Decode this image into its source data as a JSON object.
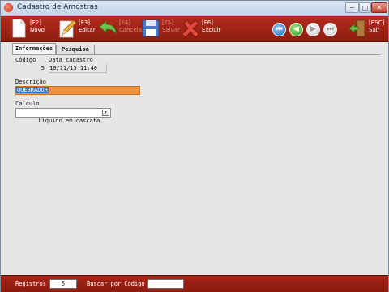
{
  "window": {
    "title": "Cadastro de Amostras"
  },
  "window_controls": {
    "minimize": "−",
    "maximize": "□",
    "close": "✕"
  },
  "toolbar": {
    "novo": {
      "key": "[F2]",
      "label": "Novo",
      "icon": "new-document-icon"
    },
    "editar": {
      "key": "[F3]",
      "label": "Editar",
      "icon": "edit-pencil-icon"
    },
    "cancelar": {
      "key": "[F4]",
      "label": "Cancelar",
      "icon": "undo-arrow-icon"
    },
    "salvar": {
      "key": "[F5]",
      "label": "Salvar",
      "icon": "floppy-disk-icon"
    },
    "excluir": {
      "key": "[F6]",
      "label": "Excluir",
      "icon": "delete-x-icon"
    },
    "sair": {
      "key": "[ESC]",
      "label": "Sair",
      "icon": "exit-door-icon"
    }
  },
  "navigation": {
    "first": {
      "glyph": "⏮",
      "icon": "first-record-icon"
    },
    "prev": {
      "glyph": "◀",
      "icon": "previous-record-icon"
    },
    "next": {
      "glyph": "▶",
      "icon": "next-record-icon"
    },
    "last": {
      "glyph": "⏭",
      "icon": "last-record-icon"
    }
  },
  "tabs": [
    {
      "label": "Informações",
      "active": true
    },
    {
      "label": "Pesquisa",
      "active": false
    }
  ],
  "form": {
    "codigo_label": "Código",
    "codigo_value": "5",
    "data_label": "Data cadastro",
    "data_value": "10/11/15 11:40",
    "descricao_label": "Descrição",
    "descricao_value": "QUEBRADOR",
    "calculo_label": "Calculo",
    "calculo_value": "Liquido em cascata",
    "calculo_arrow": "▾"
  },
  "statusbar": {
    "registros_label": "Registros",
    "registros_value": "5",
    "buscar_label": "Buscar por Código",
    "buscar_value": ""
  },
  "colors": {
    "toolbar_red": "#a02315",
    "selection_orange": "#f0923e",
    "selection_blue": "#2b74d1"
  }
}
